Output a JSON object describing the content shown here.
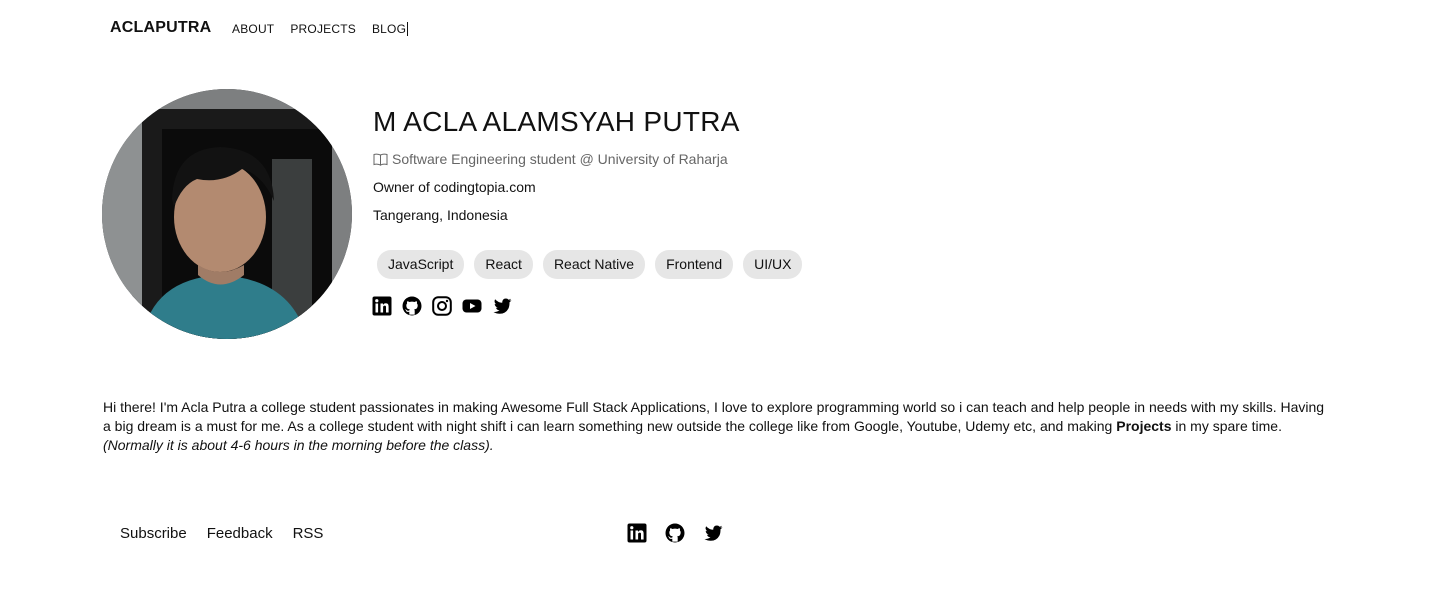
{
  "nav": {
    "brand": "ACLAPUTRA",
    "links": [
      "ABOUT",
      "PROJECTS",
      "BLOG"
    ]
  },
  "profile": {
    "name": "M ACLA ALAMSYAH PUTRA",
    "subtitle": "Software Engineering student @ University of Raharja",
    "owner": "Owner of codingtopia.com",
    "location": "Tangerang, Indonesia",
    "tags": [
      "JavaScript",
      "React",
      "React Native",
      "Frontend",
      "UI/UX"
    ],
    "socials": [
      "linkedin-icon",
      "github-icon",
      "instagram-icon",
      "youtube-icon",
      "twitter-icon"
    ]
  },
  "about": {
    "part1": "Hi there! I'm Acla Putra a college student passionates in making Awesome Full Stack Applications, I love to explore programming world so i can teach and help people in needs with my skills. Having a big dream is a must for me. As a college student with night shift i can learn something new outside the college like from Google, Youtube, Udemy etc, and making ",
    "bold": "Projects",
    "part2": " in my spare time. ",
    "italic": "(Normally it is about 4-6 hours in the morning before the class)."
  },
  "footer": {
    "links": [
      "Subscribe",
      "Feedback",
      "RSS"
    ],
    "socials": [
      "linkedin-icon",
      "github-icon",
      "twitter-icon"
    ]
  },
  "colors": {
    "text": "#111111",
    "muted": "#666666",
    "tag_bg": "#e6e6e6",
    "background": "#ffffff"
  }
}
